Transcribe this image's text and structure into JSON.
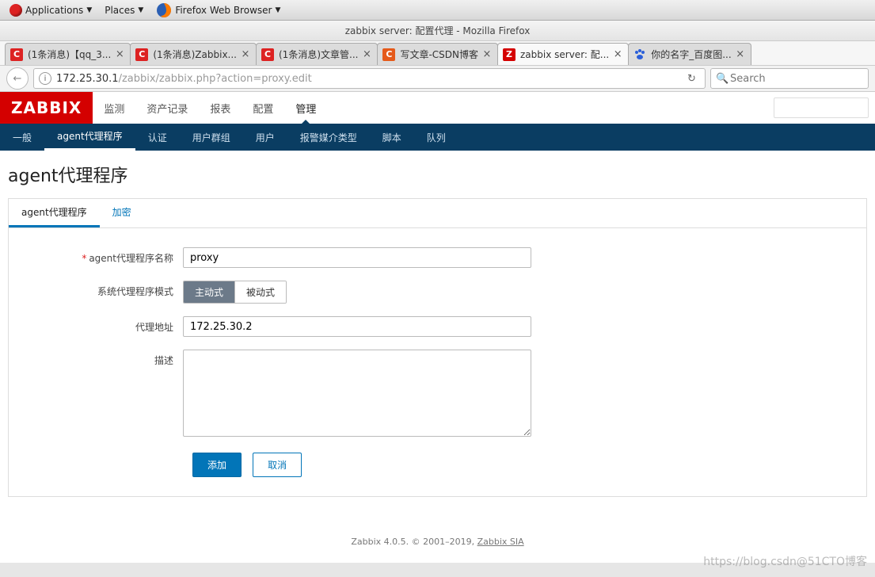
{
  "gnome": {
    "applications": "Applications",
    "places": "Places",
    "firefox_menu": "Firefox Web Browser"
  },
  "firefox": {
    "window_title": "zabbix server: 配置代理 - Mozilla Firefox",
    "url_host": "172.25.30.1",
    "url_path": "/zabbix/zabbix.php?action=proxy.edit",
    "search_placeholder": "Search",
    "tabs": [
      {
        "label": "(1条消息)【qq_3...",
        "fav": "red",
        "favtxt": "C"
      },
      {
        "label": "(1条消息)Zabbix...",
        "fav": "red",
        "favtxt": "C"
      },
      {
        "label": "(1条消息)文章管...",
        "fav": "red",
        "favtxt": "C"
      },
      {
        "label": "写文章-CSDN博客",
        "fav": "orange",
        "favtxt": "C"
      },
      {
        "label": "zabbix server: 配...",
        "fav": "zbx",
        "favtxt": "Z",
        "active": true
      },
      {
        "label": "你的名字_百度图...",
        "fav": "baidu"
      }
    ]
  },
  "zabbix": {
    "logo": "ZABBIX",
    "mainnav": [
      "监测",
      "资产记录",
      "报表",
      "配置",
      "管理"
    ],
    "mainnav_active": 4,
    "subnav": [
      "一般",
      "agent代理程序",
      "认证",
      "用户群组",
      "用户",
      "报警媒介类型",
      "脚本",
      "队列"
    ],
    "subnav_active": 1,
    "page_title": "agent代理程序",
    "form_tabs": {
      "main": "agent代理程序",
      "enc": "加密"
    },
    "labels": {
      "name": "agent代理程序名称",
      "mode": "系统代理程序模式",
      "addr": "代理地址",
      "desc": "描述"
    },
    "values": {
      "name": "proxy",
      "addr": "172.25.30.2",
      "desc": ""
    },
    "mode_options": {
      "active": "主动式",
      "passive": "被动式"
    },
    "mode_selected": "active",
    "buttons": {
      "add": "添加",
      "cancel": "取消"
    },
    "footer": {
      "text": "Zabbix 4.0.5. © 2001–2019, ",
      "link": "Zabbix SIA"
    }
  },
  "watermark": "https://blog.csdn@51CTO博客"
}
